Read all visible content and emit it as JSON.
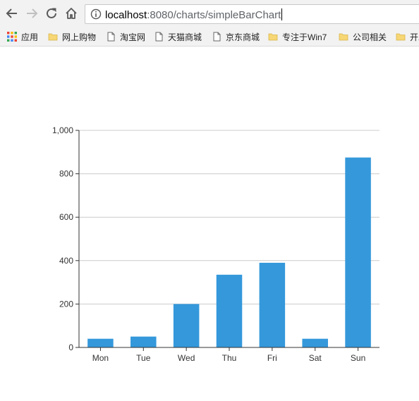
{
  "browser": {
    "url_host": "localhost",
    "url_rest": ":8080/charts/simpleBarChart",
    "bookmarks": [
      {
        "label": "应用",
        "icon": "apps-grid-icon"
      },
      {
        "label": "网上购物",
        "icon": "folder-icon"
      },
      {
        "label": "淘宝网",
        "icon": "page-icon"
      },
      {
        "label": "天猫商城",
        "icon": "page-icon"
      },
      {
        "label": "京东商城",
        "icon": "page-icon"
      },
      {
        "label": "专注于Win7",
        "icon": "folder-icon"
      },
      {
        "label": "公司相关",
        "icon": "folder-icon"
      },
      {
        "label": "开发",
        "icon": "folder-icon"
      }
    ]
  },
  "chart_data": {
    "type": "bar",
    "categories": [
      "Mon",
      "Tue",
      "Wed",
      "Thu",
      "Fri",
      "Sat",
      "Sun"
    ],
    "values": [
      40,
      50,
      200,
      335,
      390,
      40,
      875
    ],
    "ylim": [
      0,
      1000
    ],
    "yticks": [
      "0",
      "200",
      "400",
      "600",
      "800",
      "1,000"
    ],
    "grid": true,
    "bar_color": "#3498db"
  }
}
